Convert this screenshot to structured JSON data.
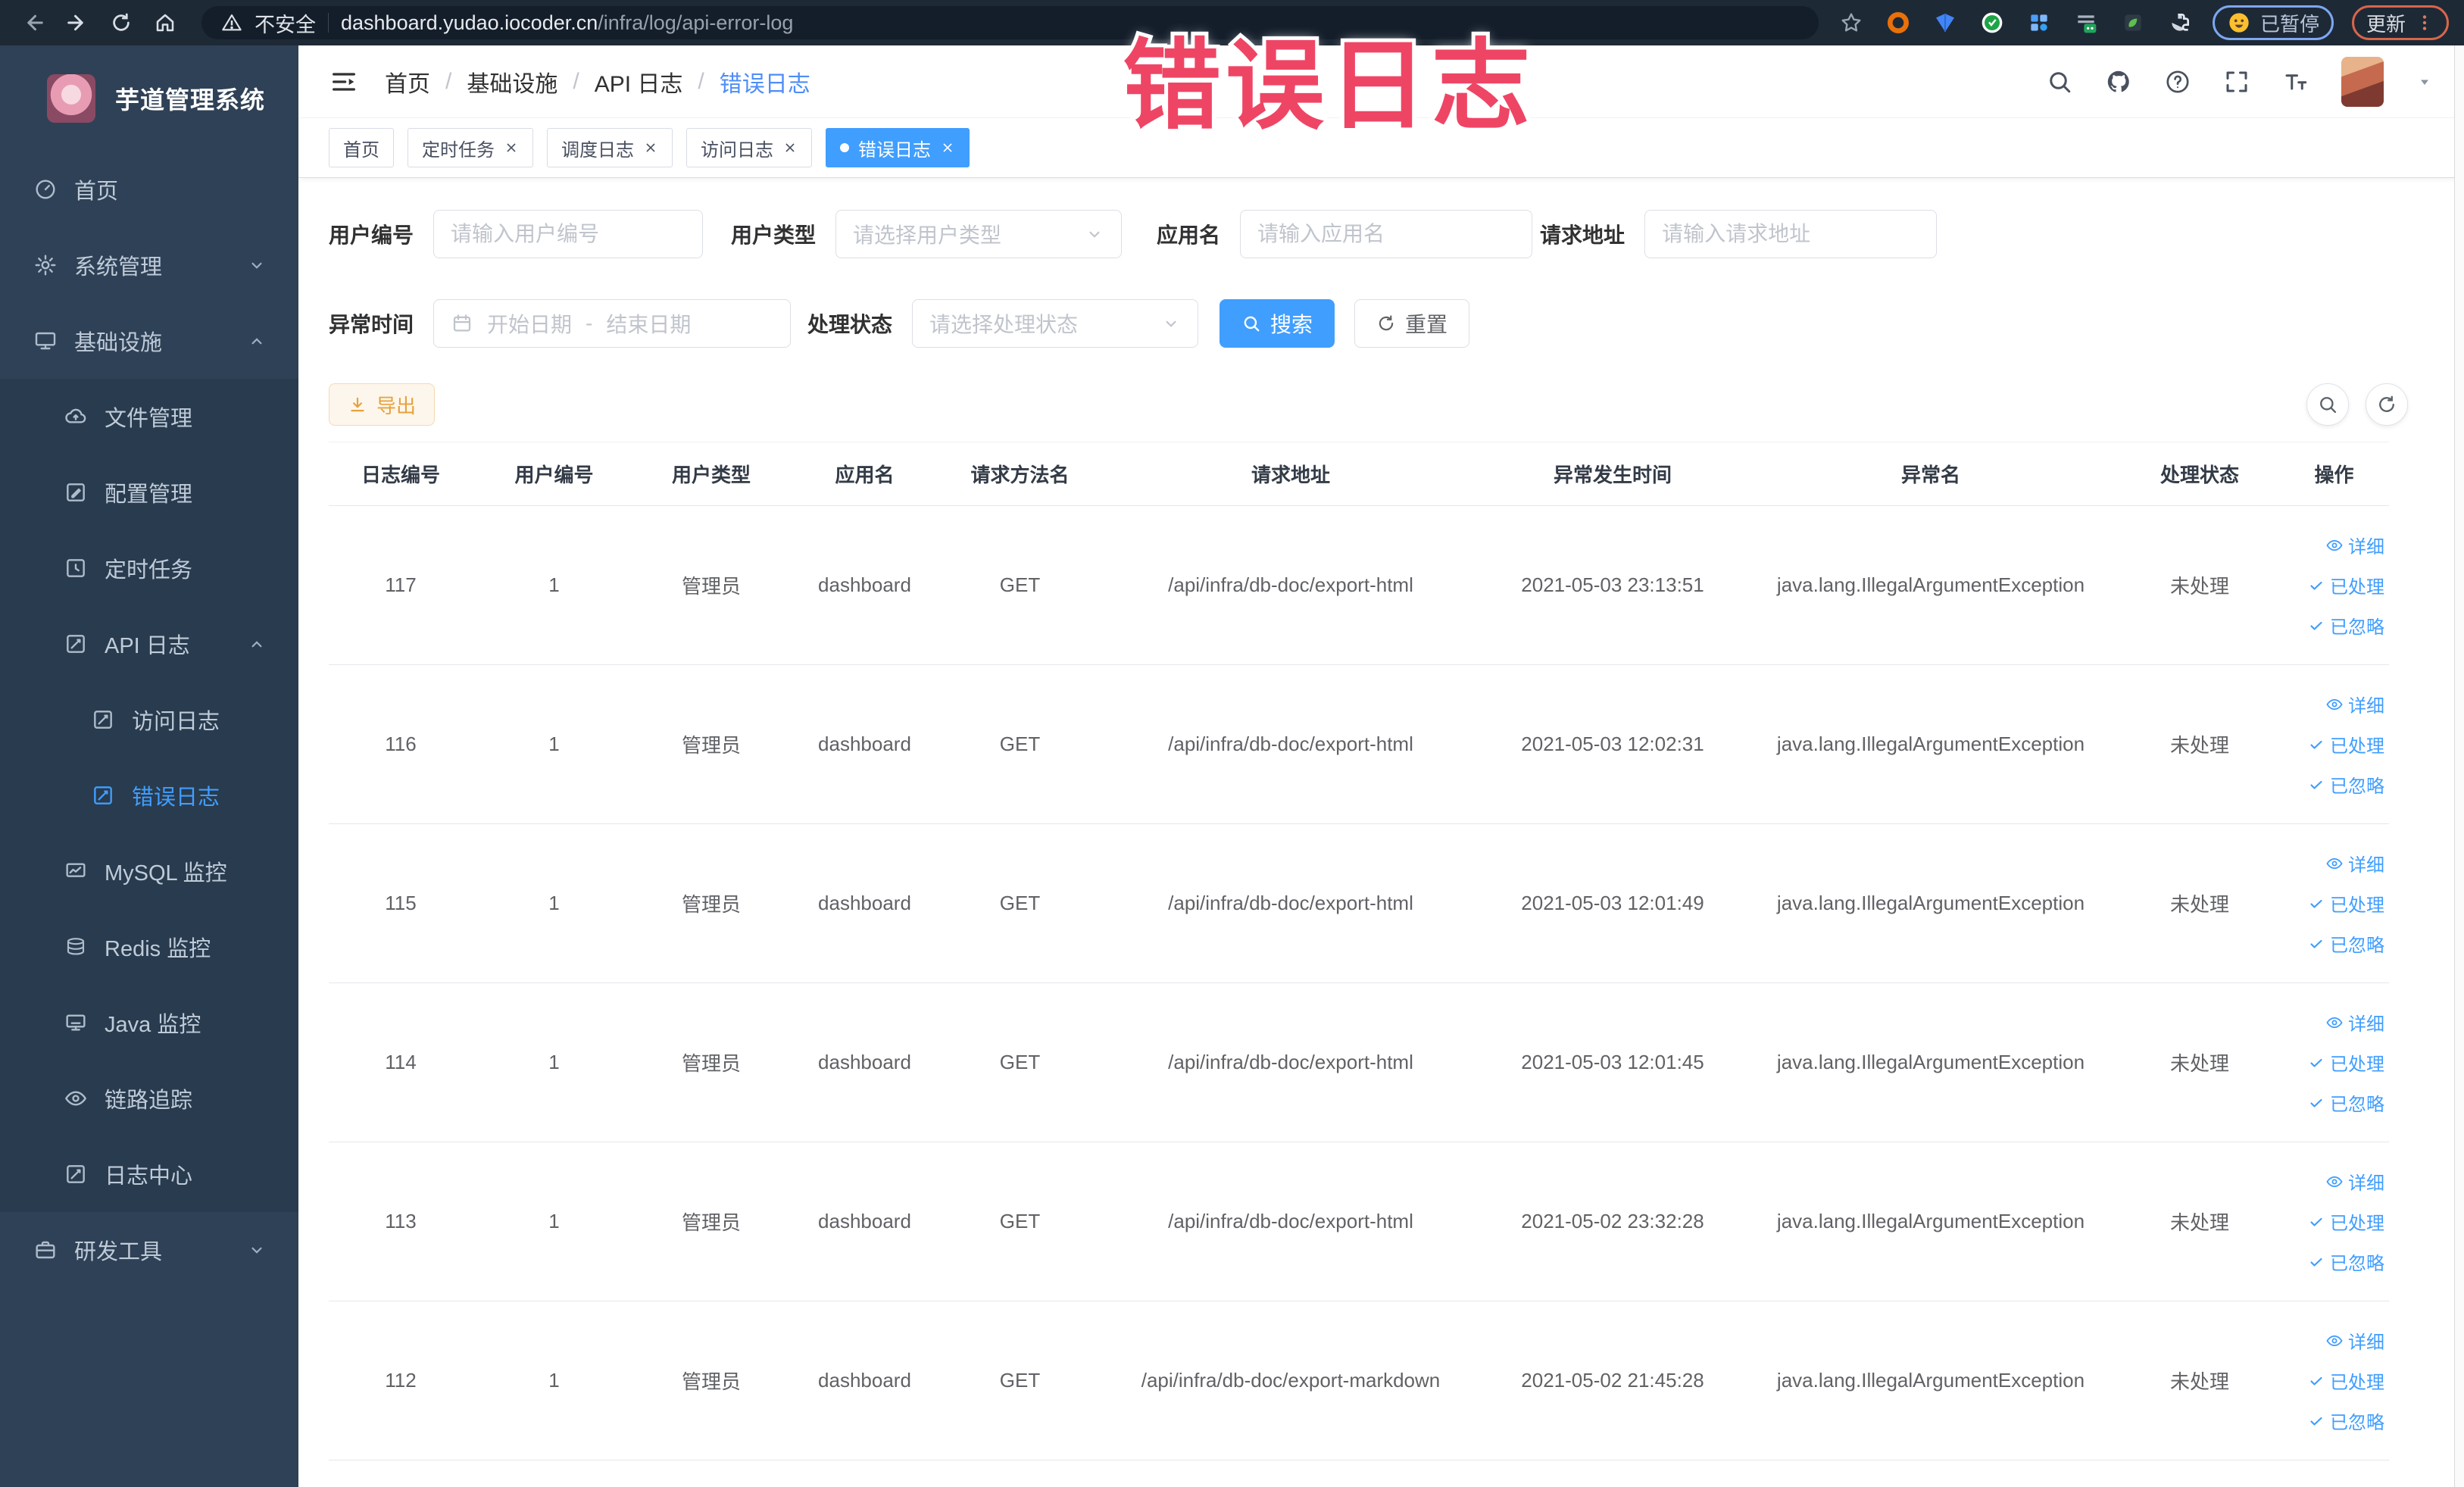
{
  "browser": {
    "security_label": "不安全",
    "url_host": "dashboard.yudao.iocoder.cn",
    "url_path": "/infra/log/api-error-log",
    "paused_badge": "已暂停",
    "update_badge": "更新"
  },
  "overlay": {
    "text": "错误日志",
    "color": "#ef4565"
  },
  "sidebar": {
    "app_title": "芋道管理系统",
    "items": [
      {
        "key": "home",
        "label": "首页",
        "icon": "dashboard-icon",
        "level": 1
      },
      {
        "key": "system",
        "label": "系统管理",
        "icon": "gear-icon",
        "level": 1,
        "chevron": "down"
      },
      {
        "key": "infra",
        "label": "基础设施",
        "icon": "monitor-icon",
        "level": 1,
        "chevron": "up"
      },
      {
        "key": "file",
        "label": "文件管理",
        "icon": "cloud-icon",
        "level": 2
      },
      {
        "key": "config",
        "label": "配置管理",
        "icon": "edit-icon",
        "level": 2
      },
      {
        "key": "job",
        "label": "定时任务",
        "icon": "timer-icon",
        "level": 2
      },
      {
        "key": "api-log",
        "label": "API 日志",
        "icon": "log-icon",
        "level": 2,
        "chevron": "up"
      },
      {
        "key": "access-log",
        "label": "访问日志",
        "icon": "log-icon",
        "level": 3
      },
      {
        "key": "error-log",
        "label": "错误日志",
        "icon": "log-icon",
        "level": 3,
        "active": true
      },
      {
        "key": "mysql",
        "label": "MySQL 监控",
        "icon": "db-chart-icon",
        "level": 2
      },
      {
        "key": "redis",
        "label": "Redis 监控",
        "icon": "redis-icon",
        "level": 2
      },
      {
        "key": "java",
        "label": "Java 监控",
        "icon": "java-icon",
        "level": 2
      },
      {
        "key": "tracer",
        "label": "链路追踪",
        "icon": "eye-icon",
        "level": 2
      },
      {
        "key": "log-center",
        "label": "日志中心",
        "icon": "log-icon",
        "level": 2
      },
      {
        "key": "dev-tools",
        "label": "研发工具",
        "icon": "briefcase-icon",
        "level": 1,
        "chevron": "down"
      }
    ]
  },
  "breadcrumb": {
    "separator": "/",
    "items": [
      {
        "label": "首页"
      },
      {
        "label": "基础设施"
      },
      {
        "label": "API 日志"
      },
      {
        "label": "错误日志",
        "current": true
      }
    ]
  },
  "tabs": [
    {
      "key": "home",
      "label": "首页",
      "closable": false,
      "active": false
    },
    {
      "key": "job",
      "label": "定时任务",
      "closable": true,
      "active": false
    },
    {
      "key": "job-log",
      "label": "调度日志",
      "closable": true,
      "active": false
    },
    {
      "key": "access-log",
      "label": "访问日志",
      "closable": true,
      "active": false
    },
    {
      "key": "error-log",
      "label": "错误日志",
      "closable": true,
      "active": true
    }
  ],
  "filters": {
    "user_id": {
      "label": "用户编号",
      "placeholder": "请输入用户编号"
    },
    "user_type": {
      "label": "用户类型",
      "placeholder": "请选择用户类型"
    },
    "app_name": {
      "label": "应用名",
      "placeholder": "请输入应用名"
    },
    "request_url": {
      "label": "请求地址",
      "placeholder": "请输入请求地址"
    },
    "exception_time": {
      "label": "异常时间",
      "start_placeholder": "开始日期",
      "separator": "-",
      "end_placeholder": "结束日期"
    },
    "process_status": {
      "label": "处理状态",
      "placeholder": "请选择处理状态"
    },
    "search_label": "搜索",
    "reset_label": "重置"
  },
  "toolbar": {
    "export_label": "导出"
  },
  "table": {
    "headers": [
      "日志编号",
      "用户编号",
      "用户类型",
      "应用名",
      "请求方法名",
      "请求地址",
      "异常发生时间",
      "异常名",
      "处理状态",
      "操作"
    ],
    "row_actions": [
      "详细",
      "已处理",
      "已忽略"
    ],
    "rows": [
      {
        "id": "117",
        "user_id": "1",
        "user_type": "管理员",
        "app_name": "dashboard",
        "method": "GET",
        "url": "/api/infra/db-doc/export-html",
        "time": "2021-05-03 23:13:51",
        "exception": "java.lang.IllegalArgumentException",
        "status": "未处理"
      },
      {
        "id": "116",
        "user_id": "1",
        "user_type": "管理员",
        "app_name": "dashboard",
        "method": "GET",
        "url": "/api/infra/db-doc/export-html",
        "time": "2021-05-03 12:02:31",
        "exception": "java.lang.IllegalArgumentException",
        "status": "未处理"
      },
      {
        "id": "115",
        "user_id": "1",
        "user_type": "管理员",
        "app_name": "dashboard",
        "method": "GET",
        "url": "/api/infra/db-doc/export-html",
        "time": "2021-05-03 12:01:49",
        "exception": "java.lang.IllegalArgumentException",
        "status": "未处理"
      },
      {
        "id": "114",
        "user_id": "1",
        "user_type": "管理员",
        "app_name": "dashboard",
        "method": "GET",
        "url": "/api/infra/db-doc/export-html",
        "time": "2021-05-03 12:01:45",
        "exception": "java.lang.IllegalArgumentException",
        "status": "未处理"
      },
      {
        "id": "113",
        "user_id": "1",
        "user_type": "管理员",
        "app_name": "dashboard",
        "method": "GET",
        "url": "/api/infra/db-doc/export-html",
        "time": "2021-05-02 23:32:28",
        "exception": "java.lang.IllegalArgumentException",
        "status": "未处理"
      },
      {
        "id": "112",
        "user_id": "1",
        "user_type": "管理员",
        "app_name": "dashboard",
        "method": "GET",
        "url": "/api/infra/db-doc/export-markdown",
        "time": "2021-05-02 21:45:28",
        "exception": "java.lang.IllegalArgumentException",
        "status": "未处理"
      }
    ]
  },
  "colors": {
    "accent": "#409eff",
    "overlay_pink": "#ef4565",
    "warning": "#e6a23c",
    "sidebar_bg": "#2f4156",
    "submenu_bg": "#293b4e",
    "browser_bar": "#1e2936"
  }
}
